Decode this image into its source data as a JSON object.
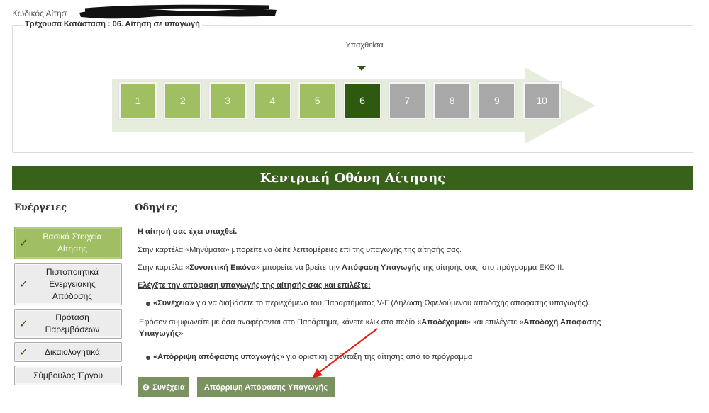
{
  "header": {
    "app_code_label": "Κωδικός Αίτησ",
    "current_status": "Τρέχουσα Κατάσταση : 06. Αίτηση σε υπαγωγή"
  },
  "progress": {
    "current_label": "Υπαχθείσα",
    "current_step": 6,
    "steps": [
      "1",
      "2",
      "3",
      "4",
      "5",
      "6",
      "7",
      "8",
      "9",
      "10"
    ]
  },
  "main": {
    "title": "Κεντρική Οθόνη Αίτησης"
  },
  "actions": {
    "title": "Ενέργειες",
    "items": [
      {
        "label": "Βασικά Στοιχεία Αίτησης",
        "checked": true
      },
      {
        "label": "Πιστοποιητικά Ενεργειακής Απόδοσης",
        "checked": true
      },
      {
        "label": "Πρόταση Παρεμβάσεων",
        "checked": true
      },
      {
        "label": "Δικαιολογητικά",
        "checked": true
      },
      {
        "label": "Σύμβουλος Έργου",
        "checked": false
      }
    ]
  },
  "instructions": {
    "title": "Οδηγίες",
    "approved": "Η αίτησή σας έχει υπαχθεί.",
    "messages_pre": "Στην καρτέλα «Μηνύματα» μπορείτε να δείτε λεπτομέρειες επί της υπαγωγής της αίτησής σας.",
    "summary_pre": "Στην καρτέλα «",
    "summary_bold": "Συνοπτική Εικόνα",
    "summary_mid": "» μπορείτε να βρείτε την ",
    "summary_bold2": "Απόφαση Υπαγωγής",
    "summary_post": " της αίτησής σας, στο πρόγραμμα ΕΚΟ ΙΙ.",
    "check_heading": "Ελέγξτε την απόφαση υπαγωγής της αίτησής σας και επιλέξτε:",
    "bullet1_bold": "«Συνέχεια»",
    "bullet1_rest": " για να διαβάσετε το περιεχόμενο του Παραρτήματος V-Γ (Δήλωση Ωφελούμενου αποδοχής απόφασης υπαγωγής).",
    "agree_pre": "Εφόσον συμφωνείτε με όσα αναφέρονται στο Παράρτημα, κάνετε κλικ στο  πεδίο «",
    "agree_bold1": "Αποδέχομαι",
    "agree_mid": "» και επιλέγετε «",
    "agree_bold2": "Αποδοχή Απόφασης",
    "agree_bold3": "Υπαγωγής",
    "agree_post": "»",
    "bullet2_bold": "«Απόρριψη απόφασης υπαγωγής»",
    "bullet2_rest": " για οριστική απένταξη της αίτησης από το πρόγραμμα"
  },
  "buttons": {
    "continue_label": "Συνέχεια",
    "reject_label": "Απόρριψη Απόφασης Υπαγωγής"
  },
  "colors": {
    "done": "#a0bf62",
    "current": "#2e5a10",
    "todo": "#a8a8a8",
    "header_bg": "#38621a",
    "button_bg": "#7a9160",
    "annotation_arrow": "#e0201a"
  }
}
